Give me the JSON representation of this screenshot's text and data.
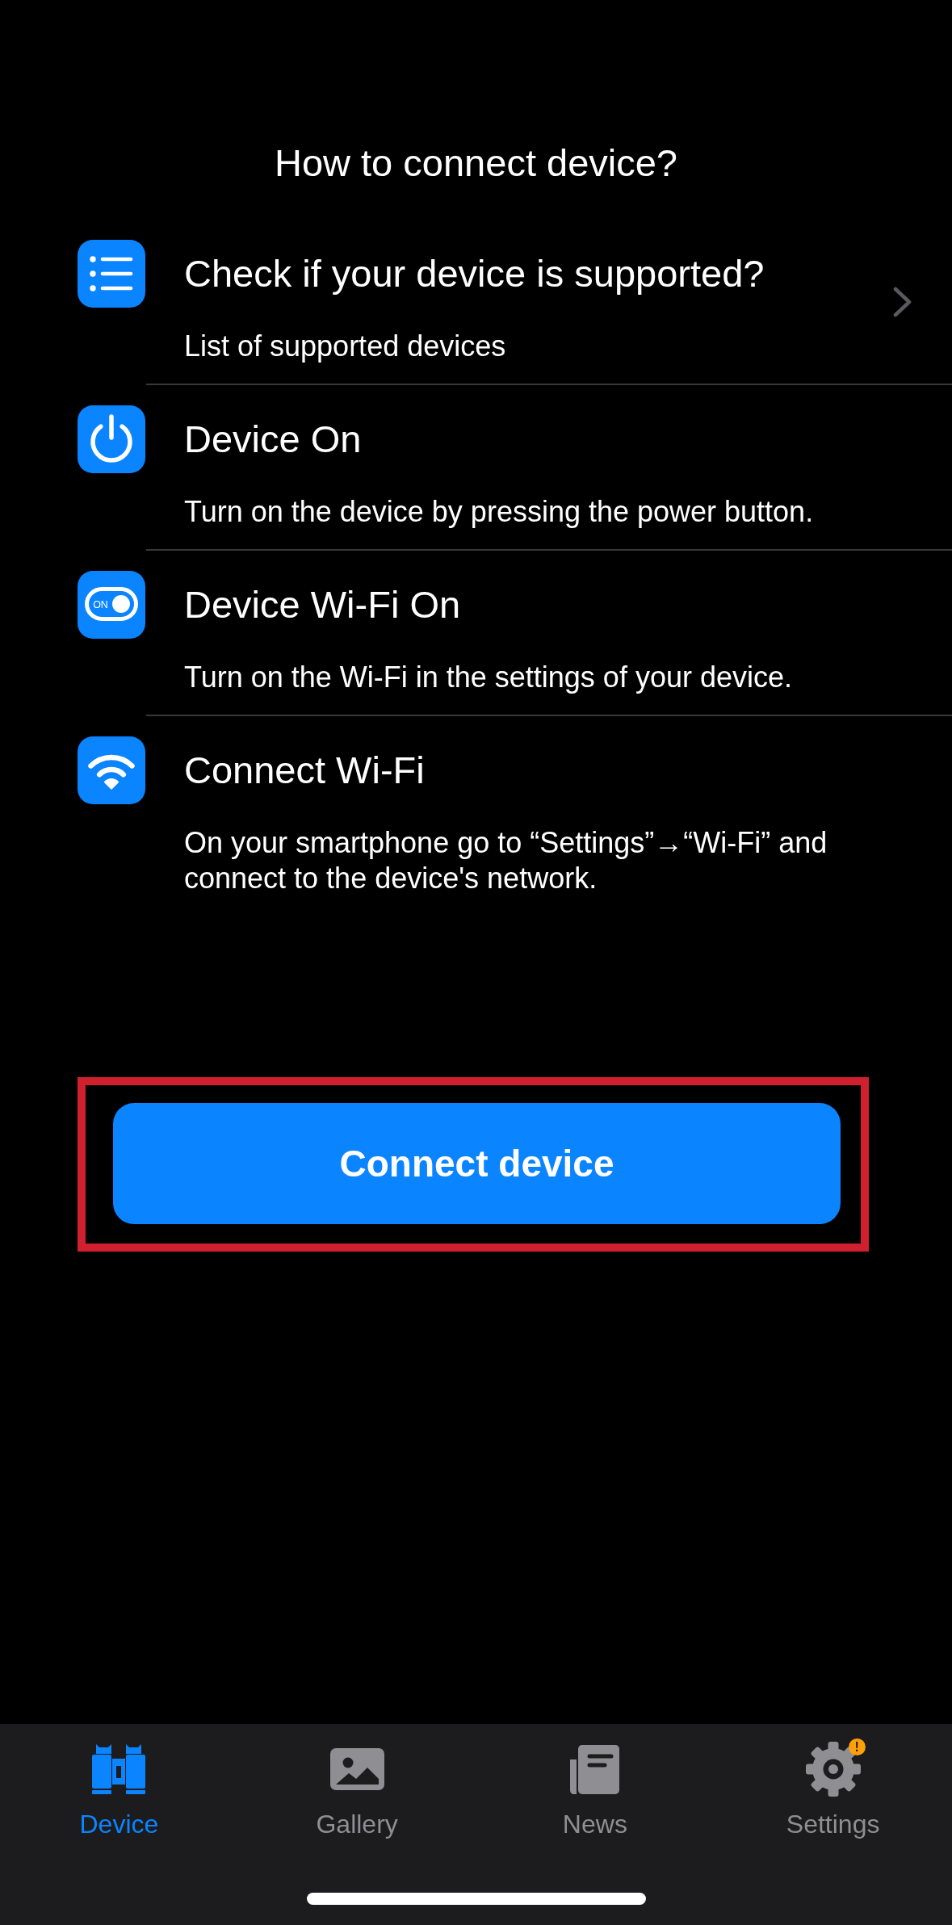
{
  "header": {
    "title": "How to connect device?"
  },
  "steps": [
    {
      "title": "Check if your device is supported?",
      "subtitle": "List of supported devices",
      "navigable": true
    },
    {
      "title": "Device On",
      "subtitle": "Turn on the device by pressing the power button.",
      "navigable": false
    },
    {
      "title": "Device Wi-Fi On",
      "subtitle": "Turn on the Wi-Fi in the settings of your device.",
      "navigable": false,
      "icon_text": "ON"
    },
    {
      "title": "Connect Wi-Fi",
      "subtitle": "On your smartphone go to “Settings”→“Wi-Fi” and connect to the device's network.",
      "navigable": false
    }
  ],
  "connect_button": {
    "label": "Connect device",
    "highlighted": true
  },
  "tab_bar": {
    "tabs": [
      {
        "label": "Device",
        "selected": true
      },
      {
        "label": "Gallery",
        "selected": false
      },
      {
        "label": "News",
        "selected": false
      },
      {
        "label": "Settings",
        "selected": false,
        "badge": "!"
      }
    ]
  }
}
